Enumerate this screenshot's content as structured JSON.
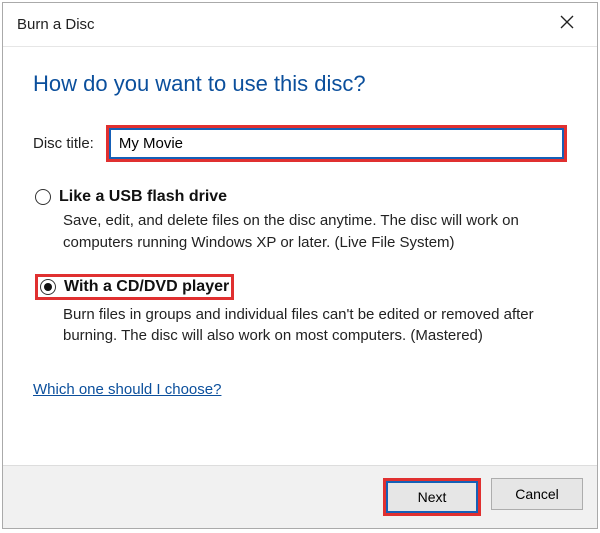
{
  "window": {
    "title": "Burn a Disc"
  },
  "heading": "How do you want to use this disc?",
  "disc_title": {
    "label": "Disc title:",
    "value": "My Movie"
  },
  "options": [
    {
      "title": "Like a USB flash drive",
      "desc": "Save, edit, and delete files on the disc anytime. The disc will work on computers running Windows XP or later. (Live File System)",
      "selected": false
    },
    {
      "title": "With a CD/DVD player",
      "desc": "Burn files in groups and individual files can't be edited or removed after burning. The disc will also work on most computers. (Mastered)",
      "selected": true
    }
  ],
  "help_link": "Which one should I choose?",
  "buttons": {
    "next": "Next",
    "cancel": "Cancel"
  }
}
